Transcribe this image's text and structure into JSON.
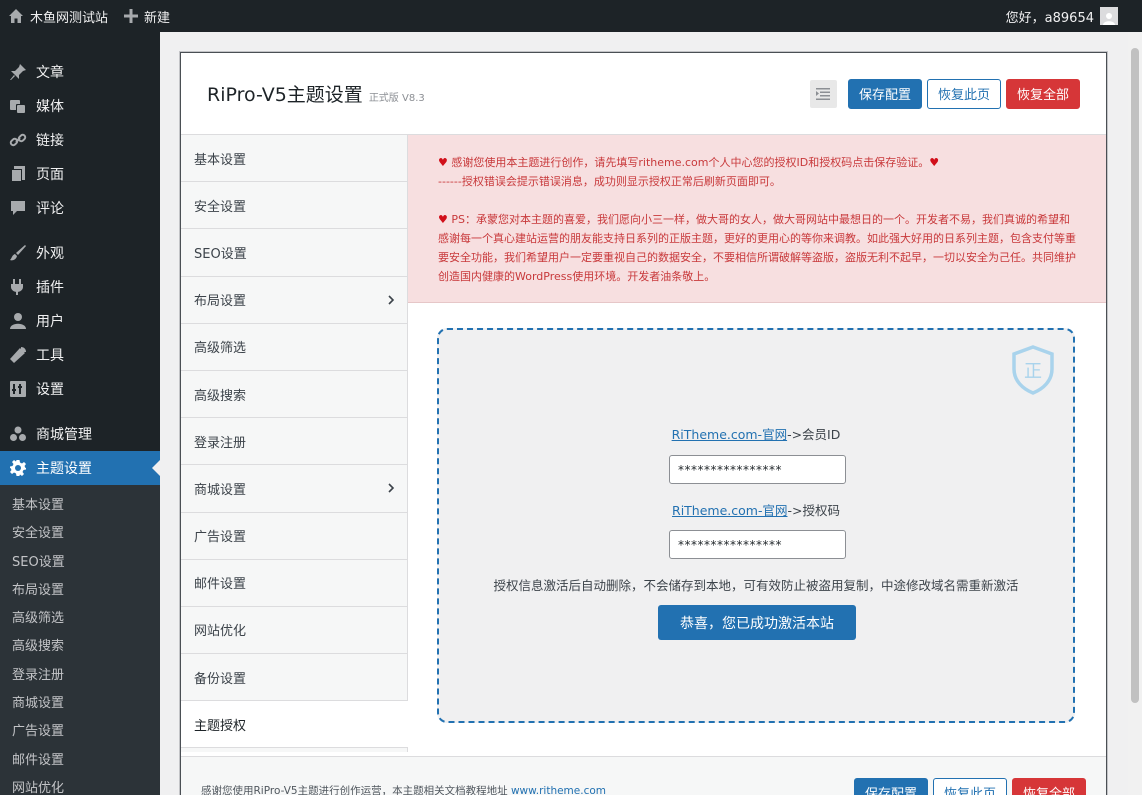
{
  "adminbar": {
    "site_name": "木鱼网测试站",
    "new_label": "新建",
    "greeting": "您好，a89654"
  },
  "menu": {
    "items": [
      {
        "label": "文章",
        "icon": "pin-icon"
      },
      {
        "label": "媒体",
        "icon": "media-icon"
      },
      {
        "label": "链接",
        "icon": "link-icon"
      },
      {
        "label": "页面",
        "icon": "page-icon"
      },
      {
        "label": "评论",
        "icon": "comment-icon"
      },
      {
        "label": "外观",
        "icon": "brush-icon"
      },
      {
        "label": "插件",
        "icon": "plugin-icon"
      },
      {
        "label": "用户",
        "icon": "user-icon"
      },
      {
        "label": "工具",
        "icon": "wrench-icon"
      },
      {
        "label": "设置",
        "icon": "settings-icon"
      },
      {
        "label": "商城管理",
        "icon": "shop-icon"
      },
      {
        "label": "主题设置",
        "icon": "gear-icon"
      }
    ],
    "submenu": [
      "基本设置",
      "安全设置",
      "SEO设置",
      "布局设置",
      "高级筛选",
      "高级搜索",
      "登录注册",
      "商城设置",
      "广告设置",
      "邮件设置",
      "网站优化"
    ]
  },
  "panel": {
    "title": "RiPro-V5主题设置",
    "version": "正式版 V8.3",
    "buttons": {
      "save": "保存配置",
      "reset_page": "恢复此页",
      "reset_all": "恢复全部"
    },
    "nav": [
      "基本设置",
      "安全设置",
      "SEO设置",
      "布局设置",
      "高级筛选",
      "高级搜索",
      "登录注册",
      "商城设置",
      "广告设置",
      "邮件设置",
      "网站优化",
      "备份设置",
      "主题授权"
    ],
    "notice": {
      "line1": "感谢您使用本主题进行创作，请先填写ritheme.com个人中心您的授权ID和授权码点击保存验证。",
      "line2": "------授权错误会提示错误消息，成功则显示授权正常后刷新页面即可。",
      "ps": "PS：承蒙您对本主题的喜爱，我们愿向小三一样，做大哥的女人，做大哥网站中最想日的一个。开发者不易，我们真诚的希望和感谢每一个真心建站运营的朋友能支持日系列的正版主题，更好的更用心的等你来调教。如此强大好用的日系列主题，包含支付等重要安全功能，我们希望用户一定要重视自己的数据安全，不要相信所谓破解等盗版，盗版无利不起早，一切以安全为己任。共同维护创造国内健康的WordPress使用环境。开发者油条敬上。"
    },
    "license": {
      "shield_glyph": "正",
      "link_text": "RiTheme.com-官网",
      "member_suffix": "->会员ID",
      "member_value": "****************",
      "code_suffix": "->授权码",
      "code_value": "****************",
      "note": "授权信息激活后自动删除，不会储存到本地，可有效防止被盗用复制，中途修改域名需重新激活",
      "success": "恭喜，您已成功激活本站"
    },
    "footer": {
      "text": "感谢您使用RiPro-V5主题进行创作运营，本主题相关文档教程地址 ",
      "link": "www.ritheme.com"
    }
  },
  "colors": {
    "accent": "#2271b1",
    "danger": "#d63638",
    "notice_bg": "#f7dfe0",
    "notice_text": "#c8393b",
    "admin_dark": "#1d2327"
  }
}
